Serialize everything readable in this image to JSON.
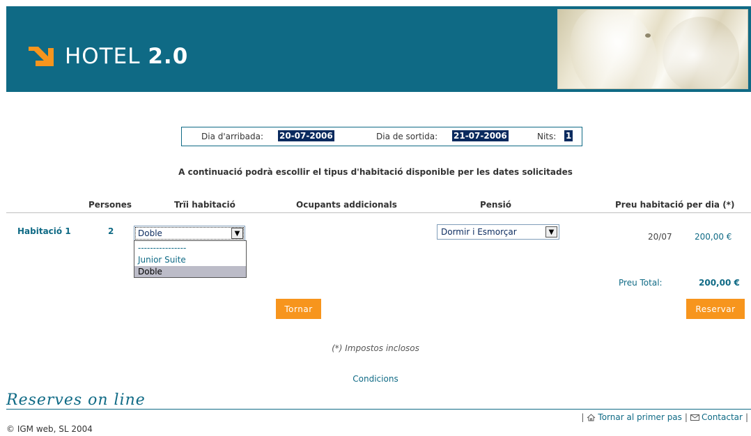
{
  "header": {
    "logo_text_light": "HOTEL ",
    "logo_text_bold": "2.0"
  },
  "dates": {
    "arrival_label": "Dia d'arribada:",
    "arrival_value": "20-07-2006",
    "departure_label": "Dia de sortida:",
    "departure_value": "21-07-2006",
    "nights_label": "Nits:",
    "nights_value": "1"
  },
  "instructions": "A continuació podrà escollir el tipus d'habitació disponible per les dates solicitades",
  "table": {
    "headers": {
      "persons": "Persones",
      "room_choice": "Trïi habitació",
      "additional": "Ocupants addicionals",
      "board": "Pensió",
      "price_per_day": "Preu habitació per dia (*)"
    },
    "row": {
      "room_label": "Habitació 1",
      "persons": "2",
      "room_selected": "Doble",
      "room_options": [
        "----------------",
        "Junior Suite",
        "Doble"
      ],
      "board_selected": "Dormir i Esmorçar",
      "date": "20/07",
      "price": "200,00 €"
    },
    "total_label": "Preu Total:",
    "total_value": "200,00 €"
  },
  "buttons": {
    "back": "Tornar",
    "book": "Reservar"
  },
  "taxes_note": "(*) Impostos inclosos",
  "conditions_link": "Condicions",
  "footer": {
    "title": "Reserves on line",
    "link_first_step": "Tornar al primer pas",
    "link_contact": "Contactar",
    "copyright": "© IGM web, SL 2004"
  },
  "colors": {
    "primary": "#0f6a85",
    "accent": "#f7951d",
    "highlight": "#0a2a5e"
  }
}
